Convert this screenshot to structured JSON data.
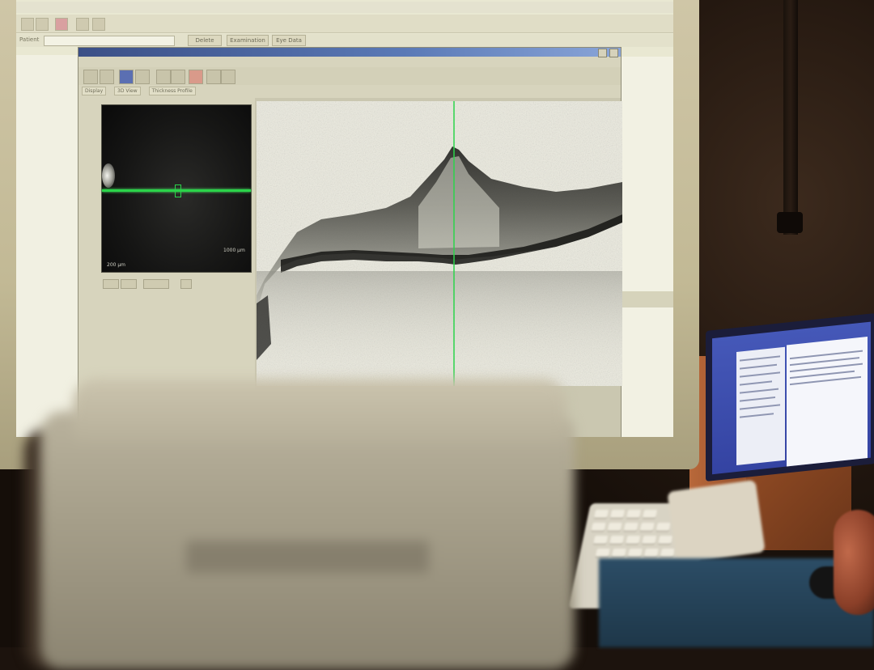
{
  "scene": "photo of a monitor showing an OCT retinal scan viewer",
  "colors": {
    "scan_line": "#2bd44a",
    "title_bar": "#3b4f86",
    "screen_bg": "#e9e8d2",
    "wood": "#8a4722",
    "laptop_desktop": "#3443a2"
  },
  "main_app": {
    "patient_label": "Patient",
    "buttons": [
      "Delete",
      "Examination",
      "Eye Data"
    ]
  },
  "icons": {
    "toolbar": [
      "open-icon",
      "save-icon",
      "search-icon",
      "print-icon",
      "settings-icon"
    ],
    "viewer_tools": [
      "pointer-icon",
      "zoom-icon",
      "save-icon",
      "measure-icon",
      "prev-arrow-icon",
      "next-arrow-icon",
      "grid-icon",
      "pen-icon",
      "eraser-icon"
    ]
  },
  "viewer": {
    "tabs": [
      "Display",
      "3D View",
      "Thickness Profile"
    ],
    "fundus": {
      "scale_label": "200 µm",
      "size_label": "1000 µm"
    }
  }
}
